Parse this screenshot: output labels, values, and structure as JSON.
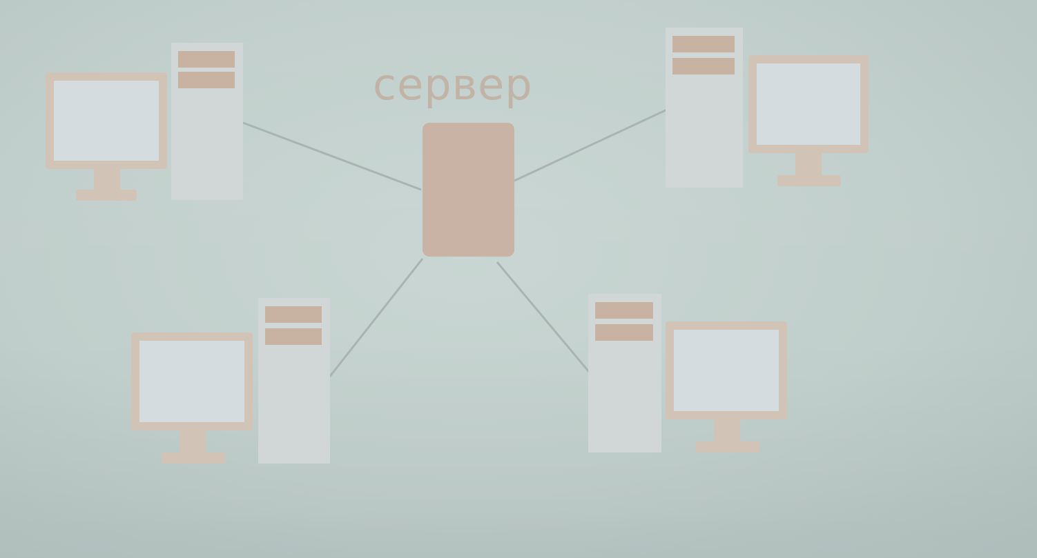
{
  "server": {
    "label": "сервер"
  },
  "workstations": [
    {
      "id": "top-left"
    },
    {
      "id": "top-right"
    },
    {
      "id": "bottom-left"
    },
    {
      "id": "bottom-right"
    }
  ],
  "colors": {
    "background": "#c4d2cf",
    "server_box": "#c8b3a4",
    "monitor_frame": "#d2c5b8",
    "monitor_screen": "#d4dbe0",
    "tower_body": "#d0d6d6",
    "tower_slot": "#c7b19e",
    "link_line": "#a8b2b0",
    "label_text": "#c1b3a6"
  }
}
